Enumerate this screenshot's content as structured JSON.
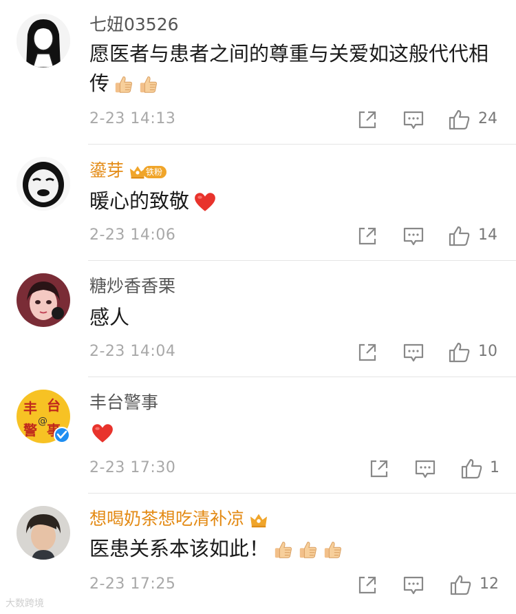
{
  "comments": [
    {
      "username": "七妞03526",
      "text": "愿医者与患者之间的尊重与关爱如这般代代相传",
      "time": "2-23 14:13",
      "likes": "24"
    },
    {
      "username": "鎏芽",
      "badge": "铁粉",
      "text": "暖心的致敬",
      "time": "2-23 14:06",
      "likes": "14"
    },
    {
      "username": "糖炒香香栗",
      "text": "感人",
      "time": "2-23 14:04",
      "likes": "10"
    },
    {
      "username": "丰台警事",
      "avatar_text": "丰台警事",
      "text": "",
      "time": "2-23 17:30",
      "likes": "1"
    },
    {
      "username": "想喝奶茶想吃清补凉",
      "text": "医患关系本该如此！",
      "time": "2-23 17:25",
      "likes": "12"
    }
  ],
  "watermark": "大数跨境",
  "colors": {
    "vip_name": "#e38a14",
    "meta": "#a8a8a8",
    "heart": "#e8332c",
    "verified": "#1f8ef1"
  },
  "icons": [
    "repost-icon",
    "comment-icon",
    "like-icon",
    "thumbs-up-emoji",
    "heart-emoji",
    "crown-badge-icon",
    "verified-icon"
  ]
}
